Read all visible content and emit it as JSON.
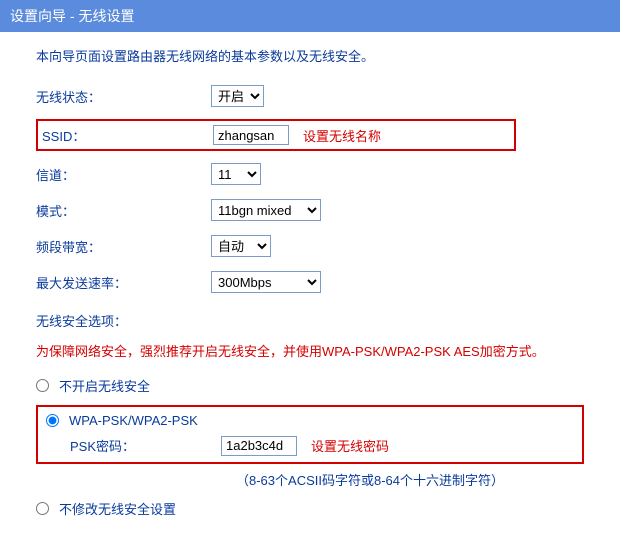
{
  "titlebar": "设置向导 - 无线设置",
  "intro": "本向导页面设置路由器无线网络的基本参数以及无线安全。",
  "form": {
    "wireless_state_label": "无线状态：",
    "wireless_state_value": "开启",
    "ssid_label": "SSID：",
    "ssid_value": "zhangsan",
    "ssid_annotation": "设置无线名称",
    "channel_label": "信道：",
    "channel_value": "11",
    "mode_label": "模式：",
    "mode_value": "11bgn mixed",
    "bandwidth_label": "频段带宽：",
    "bandwidth_value": "自动",
    "tx_rate_label": "最大发送速率：",
    "tx_rate_value": "300Mbps"
  },
  "security": {
    "section_title": "无线安全选项：",
    "warning": "为保障网络安全，强烈推荐开启无线安全，并使用WPA-PSK/WPA2-PSK AES加密方式。",
    "option_none": "不开启无线安全",
    "option_wpa": "WPA-PSK/WPA2-PSK",
    "psk_label": "PSK密码：",
    "psk_value": "1a2b3c4d",
    "psk_annotation": "设置无线密码",
    "psk_hint": "（8-63个ACSII码字符或8-64个十六进制字符）",
    "option_nochange": "不修改无线安全设置"
  }
}
